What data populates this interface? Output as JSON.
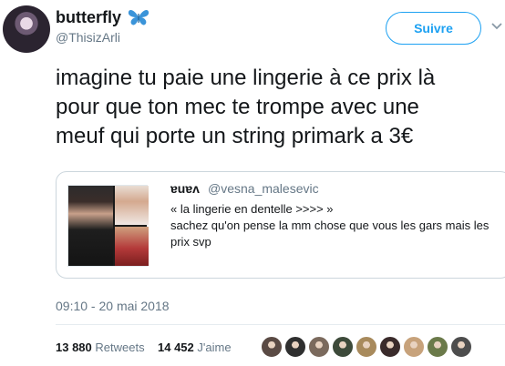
{
  "author": {
    "display_name": "butterfly",
    "handle": "@ThisizArli",
    "emoji_icon": "butterfly-icon"
  },
  "follow_label": "Suivre",
  "tweet_text": "imagine tu paie une lingerie à ce prix là\npour que ton mec te trompe avec une\nmeuf qui porte  un string primark a 3€",
  "quote": {
    "name": "ɐuɐʌ",
    "handle": "@vesna_malesevic",
    "text": "« la lingerie en dentelle >>>> »\nsachez qu'on pense la mm chose que vous les gars mais les\nprix svp"
  },
  "timestamp": "09:10 - 20 mai 2018",
  "stats": {
    "retweets_count": "13 880",
    "retweets_label": "Retweets",
    "likes_count": "14 452",
    "likes_label": "J'aime"
  },
  "colors": {
    "accent": "#1da1f2",
    "secondary_text": "#657786",
    "border": "#ccd6dd"
  },
  "likers": [
    {
      "color": "#5a4a44"
    },
    {
      "color": "#2f2f2f"
    },
    {
      "color": "#7b6a5d"
    },
    {
      "color": "#3d4a3a"
    },
    {
      "color": "#a88a5c"
    },
    {
      "color": "#3a2b2b"
    },
    {
      "color": "#c7a27b"
    },
    {
      "color": "#6b7a4a"
    },
    {
      "color": "#4d4d4d"
    }
  ]
}
